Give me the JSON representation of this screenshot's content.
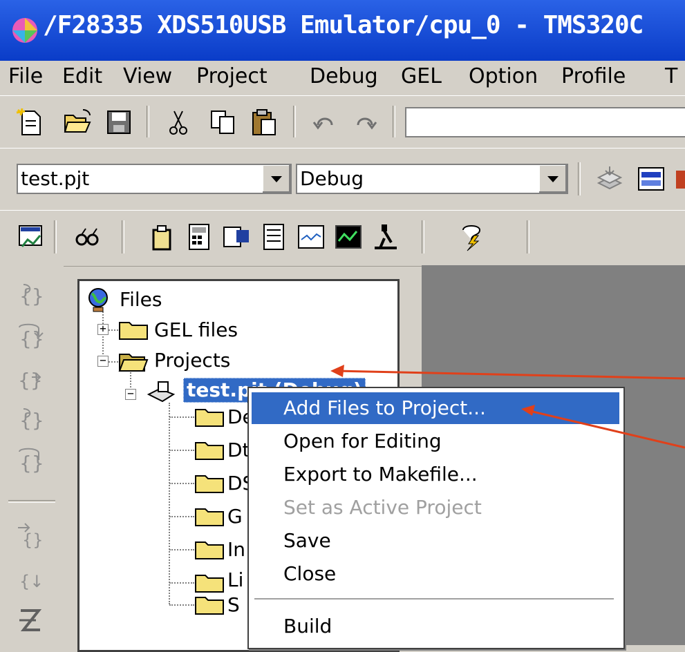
{
  "window": {
    "title": "/F28335 XDS510USB Emulator/cpu_0 - TMS320C",
    "app_icon": "ccs-app-icon"
  },
  "menu": [
    "File",
    "Edit",
    "View",
    "Project",
    "Debug",
    "GEL",
    "Option",
    "Profile",
    "T"
  ],
  "toolbar1": {
    "icons": [
      "new-file-icon",
      "open-folder-icon",
      "save-icon",
      "cut-icon",
      "copy-icon",
      "paste-icon",
      "undo-icon",
      "redo-icon"
    ],
    "search_value": ""
  },
  "project_bar": {
    "project_value": "test.pjt",
    "config_value": "Debug"
  },
  "toolbar3": {
    "icons": [
      "watch-window-icon",
      "glasses-icon",
      "memory-icon",
      "calculator-icon",
      "registers-icon",
      "disassembly-icon",
      "graph-icon",
      "plot-icon",
      "microscope-icon",
      "help-bolt-icon"
    ]
  },
  "left_toolbar": {
    "icons": [
      "step-into-icon",
      "step-over-icon",
      "step-out-icon",
      "run-to-cursor-icon",
      "set-pc-icon",
      "asm-step-into-icon",
      "asm-step-over-icon",
      "animate-icon"
    ]
  },
  "tree": {
    "root": "Files",
    "gel": "GEL files",
    "projects": "Projects",
    "project": "test.pjt (Debug)",
    "children": [
      "De",
      "Dt",
      "DS",
      "G",
      "In",
      "Li",
      "S"
    ]
  },
  "context_menu": {
    "items": [
      {
        "label": "Add Files to Project...",
        "state": "highlighted"
      },
      {
        "label": "Open for Editing",
        "state": "normal"
      },
      {
        "label": "Export to Makefile...",
        "state": "normal"
      },
      {
        "label": "Set as Active Project",
        "state": "disabled"
      },
      {
        "label": "Save",
        "state": "normal"
      },
      {
        "label": "Close",
        "state": "normal"
      },
      {
        "label": "Build",
        "state": "normal"
      }
    ]
  },
  "colors": {
    "titlebar": "#0a3cc8",
    "highlight": "#316ac5",
    "arrow": "#e0401a"
  }
}
